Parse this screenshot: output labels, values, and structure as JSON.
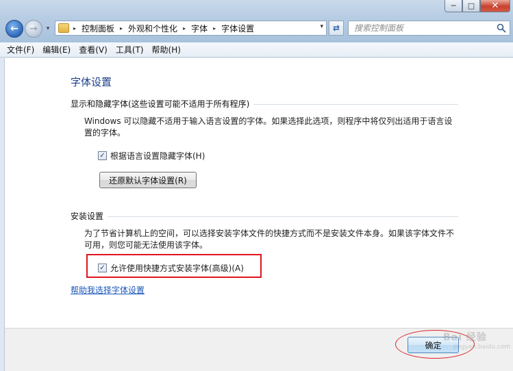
{
  "window": {
    "minimize_glyph": "─",
    "maximize_glyph": "□",
    "close_glyph": "✕"
  },
  "nav": {
    "back_glyph": "←",
    "forward_glyph": "→",
    "dropdown_glyph": "▾",
    "refresh_glyph": "⇄"
  },
  "address": {
    "crumbs": [
      "控制面板",
      "外观和个性化",
      "字体",
      "字体设置"
    ],
    "separator": "▸"
  },
  "search": {
    "placeholder": "搜索控制面板"
  },
  "menu": {
    "items": [
      "文件(F)",
      "编辑(E)",
      "查看(V)",
      "工具(T)",
      "帮助(H)"
    ]
  },
  "content": {
    "title": "字体设置",
    "section1": {
      "heading": "显示和隐藏字体(这些设置可能不适用于所有程序)",
      "description": "Windows 可以隐藏不适用于输入语言设置的字体。如果选择此选项，则程序中将仅列出适用于语言设置的字体。",
      "checkbox_label": "根据语言设置隐藏字体(H)",
      "checkbox_checked": true,
      "restore_button": "还原默认字体设置(R)"
    },
    "section2": {
      "heading": "安装设置",
      "description": "为了节省计算机上的空间，可以选择安装字体文件的快捷方式而不是安装文件本身。如果该字体文件不可用，则您可能无法使用该字体。",
      "checkbox_label": "允许使用快捷方式安装字体(高级)(A)",
      "checkbox_checked": true
    },
    "help_link": "帮助我选择字体设置"
  },
  "footer": {
    "ok_button": "确定"
  },
  "watermark": {
    "brand": "Bai 经验",
    "url": "jingyan.baidu.com"
  },
  "colors": {
    "title_blue": "#1c3f8a",
    "link_blue": "#1a56b8",
    "annotation_red": "#e0141e"
  }
}
